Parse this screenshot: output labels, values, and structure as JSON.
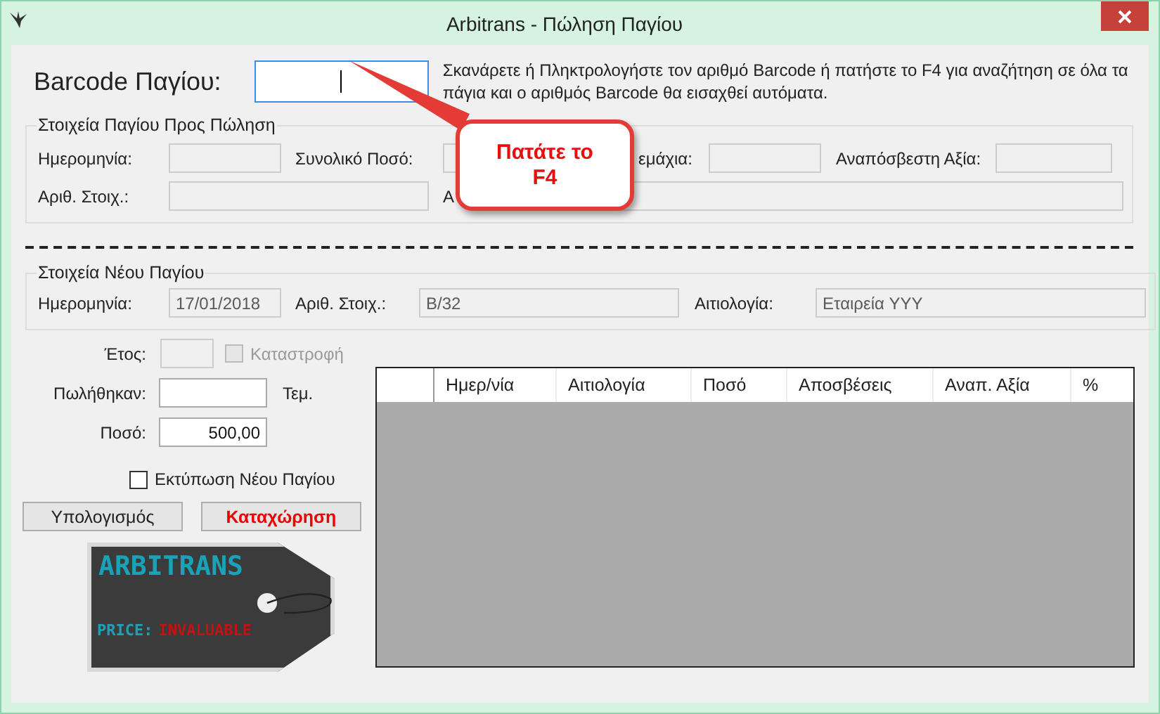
{
  "window": {
    "title": "Arbitrans - Πώληση Παγίου"
  },
  "barcode": {
    "label": "Barcode Παγίου:",
    "hint": "Σκανάρετε ή Πληκτρολογήστε τον αριθμό Barcode ή πατήστε το F4 για αναζήτηση σε όλα τα πάγια και ο αριθμός Barcode θα εισαχθεί αυτόματα."
  },
  "asset_group": {
    "title": "Στοιχεία Παγίου Προς Πώληση",
    "rows": [
      [
        {
          "label": "Ημερομηνία:"
        },
        {
          "label": "Συνολικό Ποσό:"
        },
        {
          "label": "εμάχια:"
        },
        {
          "label": "Αναπόσβεστη Αξία:"
        }
      ],
      [
        {
          "label": "Αριθ. Στοιχ.:"
        },
        {
          "label": "Α"
        }
      ]
    ]
  },
  "callout": {
    "text": "Πατάτε το F4"
  },
  "new_asset_group": {
    "title": "Στοιχεία Νέου Παγίου",
    "fields": [
      {
        "label": "Ημερομηνία:",
        "value": "17/01/2018"
      },
      {
        "label": "Αριθ. Στοιχ.:",
        "value": "B/32"
      },
      {
        "label": "Αιτιολογία:",
        "value": "Εταιρεία YYY"
      }
    ]
  },
  "year": {
    "label": "Έτος:",
    "disabled": true
  },
  "destruction": {
    "label": "Καταστροφή",
    "checked": false,
    "disabled": true
  },
  "sold": {
    "label": "Πωλήθηκαν:",
    "unit": "Τεμ."
  },
  "amount": {
    "label": "Ποσό:",
    "value": "500,00"
  },
  "print_new": {
    "label": "Εκτύπωση Νέου Παγίου",
    "checked": false
  },
  "buttons": [
    {
      "label": "Υπολογισμός",
      "kind": "normal"
    },
    {
      "label": "Καταχώρηση",
      "kind": "primary"
    }
  ],
  "logo": {
    "name": "ARBITRANS",
    "price_label": "PRICE:",
    "price_value": "INVALUABLE"
  },
  "table": {
    "columns": [
      "Ημερ/νία",
      "Αιτιολογία",
      "Ποσό",
      "Αποσβέσεις",
      "Αναπ. Αξία",
      "%"
    ]
  }
}
